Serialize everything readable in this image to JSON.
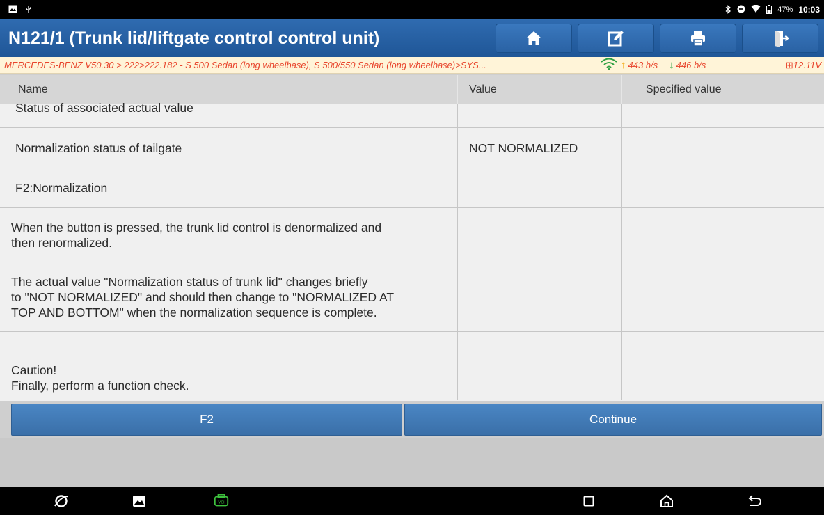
{
  "status_bar": {
    "battery": "47%",
    "time": "10:03",
    "icons": [
      "image-icon",
      "usb-icon",
      "bluetooth-icon",
      "do-not-disturb-icon",
      "wifi-icon",
      "battery-icon"
    ]
  },
  "header": {
    "title": "N121/1 (Trunk lid/liftgate control control unit)",
    "buttons": [
      "home-icon",
      "edit-icon",
      "print-icon",
      "exit-icon"
    ]
  },
  "breadcrumb": {
    "path": "MERCEDES-BENZ V50.30 > 222>222.182 - S 500 Sedan (long wheelbase), S 500/550 Sedan (long wheelbase)>SYS...",
    "upload": "443 b/s",
    "download": "446 b/s",
    "voltage": "12.11V"
  },
  "table": {
    "headers": [
      "Name",
      "Value",
      "Specified value"
    ],
    "rows": [
      {
        "name": "Status of associated actual value",
        "value": "",
        "spec": ""
      },
      {
        "name": "Normalization status of tailgate",
        "value": "NOT NORMALIZED",
        "spec": ""
      },
      {
        "name": "F2:Normalization",
        "value": "",
        "spec": ""
      },
      {
        "name": " When the button is pressed, the trunk lid control is denormalized and\nthen renormalized.",
        "value": "",
        "spec": ""
      },
      {
        "name": " The actual value \"Normalization status of trunk lid\" changes briefly\nto \"NOT NORMALIZED\" and should then change to \"NORMALIZED AT\nTOP AND BOTTOM\" when the normalization sequence is complete.",
        "value": "",
        "spec": ""
      },
      {
        "name": "\nCaution!\nFinally, perform a function check.",
        "value": "",
        "spec": ""
      }
    ]
  },
  "actions": {
    "f2": "F2",
    "continue": "Continue"
  },
  "colors": {
    "header_bg": "#2a62a4",
    "breadcrumb_text": "#e8442c",
    "button_bg": "#3f78b6"
  }
}
